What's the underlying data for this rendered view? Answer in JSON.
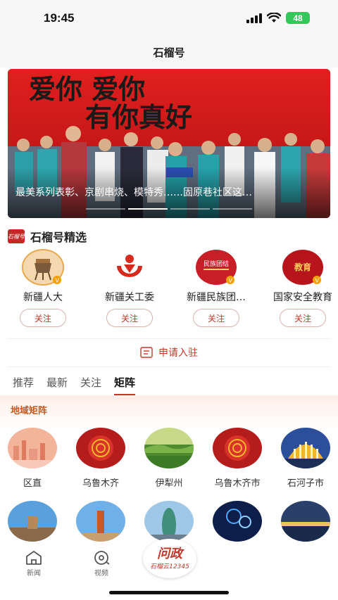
{
  "status_bar": {
    "time": "19:45",
    "battery": "48"
  },
  "header": {
    "title": "石榴号"
  },
  "banner": {
    "slogan_line1": "爱你 爱你",
    "slogan_line2": "有你真好",
    "caption": "最美系列表彰、京剧串烧、模特秀……固原巷社区这…"
  },
  "featured": {
    "logo_text": "石榴号",
    "title": "石榴号精选",
    "follow_label": "关注",
    "accounts": [
      {
        "name": "新疆人大",
        "avatar_icon": "tripod-icon",
        "verified": true
      },
      {
        "name": "新疆关工委",
        "avatar_icon": "guangongwei-icon",
        "verified": false
      },
      {
        "name": "新疆民族团…",
        "avatar_icon": "ethnic-unity-icon",
        "avatar_text": "民族团结",
        "verified": true
      },
      {
        "name": "国家安全教育",
        "avatar_icon": "security-edu-icon",
        "avatar_text": "教育",
        "verified": true
      }
    ]
  },
  "apply": {
    "label": "申请入驻"
  },
  "tabs": [
    {
      "label": "推荐",
      "active": false
    },
    {
      "label": "最新",
      "active": false
    },
    {
      "label": "关注",
      "active": false
    },
    {
      "label": "矩阵",
      "active": true
    }
  ],
  "region": {
    "title": "地域矩阵",
    "items": [
      {
        "label": "区直"
      },
      {
        "label": "乌鲁木齐"
      },
      {
        "label": "伊犁州"
      },
      {
        "label": "乌鲁木齐市"
      },
      {
        "label": "石河子市"
      }
    ]
  },
  "bottom_nav": {
    "news_label": "新闻",
    "video_label": "视频",
    "center_big": "问政",
    "center_small": "石榴云12345"
  },
  "colors": {
    "accent": "#c0392b",
    "region_title": "#c65a1e",
    "banner_red": "#d21c1c"
  }
}
